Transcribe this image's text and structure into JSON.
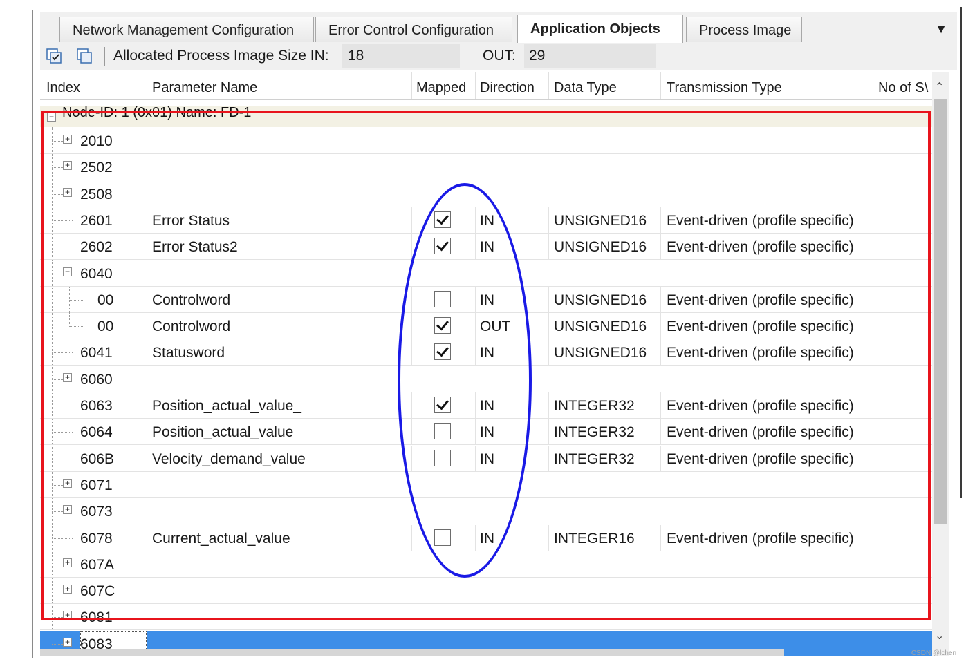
{
  "tabs": [
    {
      "label": "Network Management Configuration",
      "active": false
    },
    {
      "label": "Error Control Configuration",
      "active": false
    },
    {
      "label": "Application Objects",
      "active": true
    },
    {
      "label": "Process Image",
      "active": false
    }
  ],
  "tab_dropdown_icon": "chevron-down-icon",
  "toolbar": {
    "icons": [
      "checked-list-icon",
      "copy-list-icon"
    ],
    "allocated_label": "Allocated Process Image Size IN:",
    "in_value": "18",
    "out_label": "OUT:",
    "out_value": "29"
  },
  "columns": [
    "Index",
    "Parameter Name",
    "Mapped",
    "Direction",
    "Data Type",
    "Transmission Type",
    "No of S\\"
  ],
  "node_label": "Node-ID: 1 (0x01) Name: FD-1",
  "rows": [
    {
      "index": "2010",
      "expander": "+",
      "name": "",
      "mapped": null,
      "direction": "",
      "type": "",
      "transmission": ""
    },
    {
      "index": "2502",
      "expander": "+",
      "name": "",
      "mapped": null,
      "direction": "",
      "type": "",
      "transmission": ""
    },
    {
      "index": "2508",
      "expander": "+",
      "name": "",
      "mapped": null,
      "direction": "",
      "type": "",
      "transmission": ""
    },
    {
      "index": "2601",
      "expander": "",
      "name": "Error Status",
      "mapped": true,
      "direction": "IN",
      "type": "UNSIGNED16",
      "transmission": "Event-driven (profile specific)"
    },
    {
      "index": "2602",
      "expander": "",
      "name": "Error Status2",
      "mapped": true,
      "direction": "IN",
      "type": "UNSIGNED16",
      "transmission": "Event-driven (profile specific)"
    },
    {
      "index": "6040",
      "expander": "−",
      "name": "",
      "mapped": null,
      "direction": "",
      "type": "",
      "transmission": ""
    },
    {
      "index": "00",
      "expander": "",
      "name": "Controlword",
      "mapped": false,
      "direction": "IN",
      "type": "UNSIGNED16",
      "transmission": "Event-driven (profile specific)",
      "child": true
    },
    {
      "index": "00",
      "expander": "",
      "name": "Controlword",
      "mapped": true,
      "direction": "OUT",
      "type": "UNSIGNED16",
      "transmission": "Event-driven (profile specific)",
      "child": true
    },
    {
      "index": "6041",
      "expander": "",
      "name": "Statusword",
      "mapped": true,
      "direction": "IN",
      "type": "UNSIGNED16",
      "transmission": "Event-driven (profile specific)"
    },
    {
      "index": "6060",
      "expander": "+",
      "name": "",
      "mapped": null,
      "direction": "",
      "type": "",
      "transmission": ""
    },
    {
      "index": "6063",
      "expander": "",
      "name": "Position_actual_value_",
      "mapped": true,
      "direction": "IN",
      "type": "INTEGER32",
      "transmission": "Event-driven (profile specific)"
    },
    {
      "index": "6064",
      "expander": "",
      "name": "Position_actual_value",
      "mapped": false,
      "direction": "IN",
      "type": "INTEGER32",
      "transmission": "Event-driven (profile specific)"
    },
    {
      "index": "606B",
      "expander": "",
      "name": "Velocity_demand_value",
      "mapped": false,
      "direction": "IN",
      "type": "INTEGER32",
      "transmission": "Event-driven (profile specific)"
    },
    {
      "index": "6071",
      "expander": "+",
      "name": "",
      "mapped": null,
      "direction": "",
      "type": "",
      "transmission": ""
    },
    {
      "index": "6073",
      "expander": "+",
      "name": "",
      "mapped": null,
      "direction": "",
      "type": "",
      "transmission": ""
    },
    {
      "index": "6078",
      "expander": "",
      "name": "Current_actual_value",
      "mapped": false,
      "direction": "IN",
      "type": "INTEGER16",
      "transmission": "Event-driven (profile specific)"
    },
    {
      "index": "607A",
      "expander": "+",
      "name": "",
      "mapped": null,
      "direction": "",
      "type": "",
      "transmission": ""
    },
    {
      "index": "607C",
      "expander": "+",
      "name": "",
      "mapped": null,
      "direction": "",
      "type": "",
      "transmission": ""
    },
    {
      "index": "6081",
      "expander": "+",
      "name": "",
      "mapped": null,
      "direction": "",
      "type": "",
      "transmission": ""
    },
    {
      "index": "6083",
      "expander": "+",
      "name": "",
      "mapped": null,
      "direction": "",
      "type": "",
      "transmission": "",
      "selected": true
    }
  ],
  "scroll_up_icon": "^",
  "scroll_down_icon": "v",
  "annotation_colors": {
    "red_box": "#e8141c",
    "blue_ellipse": "#1a1ae6"
  },
  "selection_color": "#3d8ee8",
  "watermark": "CSDN @lchen"
}
